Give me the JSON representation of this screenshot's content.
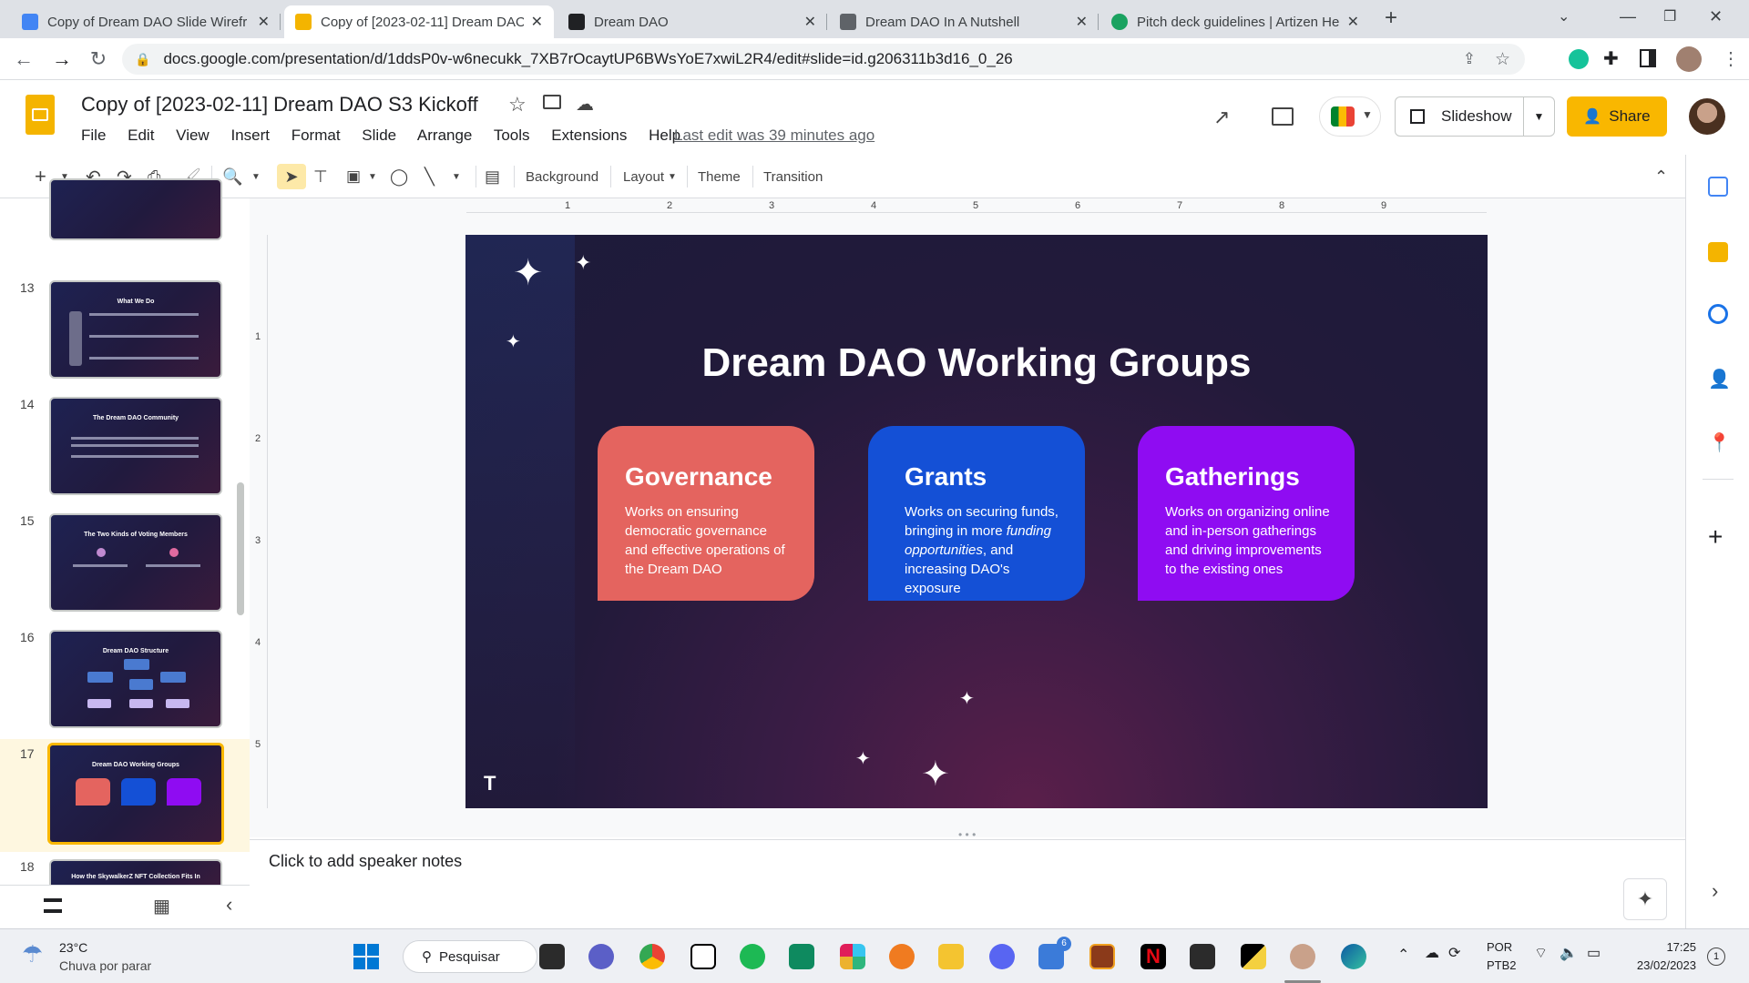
{
  "browser": {
    "tabs": [
      {
        "title": "Copy of Dream DAO Slide Wirefr",
        "active": false,
        "color": "#4285f4"
      },
      {
        "title": "Copy of [2023-02-11] Dream DAO",
        "active": true,
        "color": "#f4b400"
      },
      {
        "title": "Dream DAO",
        "active": false,
        "color": "#202124"
      },
      {
        "title": "Dream DAO In A Nutshell",
        "active": false,
        "color": "#5f6368"
      },
      {
        "title": "Pitch deck guidelines | Artizen He",
        "active": false,
        "color": "#1aa260"
      }
    ],
    "url": "docs.google.com/presentation/d/1ddsP0v-w6necukk_7XB7rOcaytUP6BWsYoE7xwiL2R4/edit#slide=id.g206311b3d16_0_26"
  },
  "doc": {
    "title": "Copy of [2023-02-11] Dream DAO S3 Kickoff",
    "menu": [
      "File",
      "Edit",
      "View",
      "Insert",
      "Format",
      "Slide",
      "Arrange",
      "Tools",
      "Extensions",
      "Help"
    ],
    "last_edit": "Last edit was 39 minutes ago",
    "slideshow_label": "Slideshow",
    "share_label": "Share"
  },
  "toolbar": {
    "background": "Background",
    "layout": "Layout",
    "theme": "Theme",
    "transition": "Transition"
  },
  "ruler": [
    "1",
    "2",
    "3",
    "4",
    "5",
    "6",
    "7",
    "8",
    "9"
  ],
  "vruler": [
    "1",
    "2",
    "3",
    "4",
    "5"
  ],
  "filmstrip": [
    {
      "num": "13",
      "title": "What We Do"
    },
    {
      "num": "14",
      "title": "The Dream DAO Community"
    },
    {
      "num": "15",
      "title": "The Two Kinds of Voting Members"
    },
    {
      "num": "16",
      "title": "Dream DAO Structure"
    },
    {
      "num": "17",
      "title": "Dream DAO Working Groups",
      "selected": true
    },
    {
      "num": "18",
      "title": "How the SkywalkerZ NFT Collection Fits In"
    }
  ],
  "slide": {
    "title": "Dream DAO Working Groups",
    "corner_mark": "T",
    "cards": [
      {
        "title": "Governance",
        "body": "Works on ensuring democratic governance and effective operations of the Dream DAO",
        "color": "#e4645f"
      },
      {
        "title": "Grants",
        "body_pre": "Works on securing funds, bringing in more ",
        "body_em": "funding opportunities",
        "body_post": ", and increasing DAO's exposure",
        "color": "#1450d6"
      },
      {
        "title": "Gatherings",
        "body": "Works on organizing online and in-person gatherings and driving improvements to the existing ones",
        "color": "#8f0cf2"
      }
    ]
  },
  "notes_placeholder": "Click to add speaker notes",
  "taskbar": {
    "weather_temp": "23°C",
    "weather_desc": "Chuva por parar",
    "search_label": "Pesquisar",
    "lang_top": "POR",
    "lang_bottom": "PTB2",
    "time": "17:25",
    "date": "23/02/2023",
    "notif_count": "1",
    "badge": "6"
  }
}
